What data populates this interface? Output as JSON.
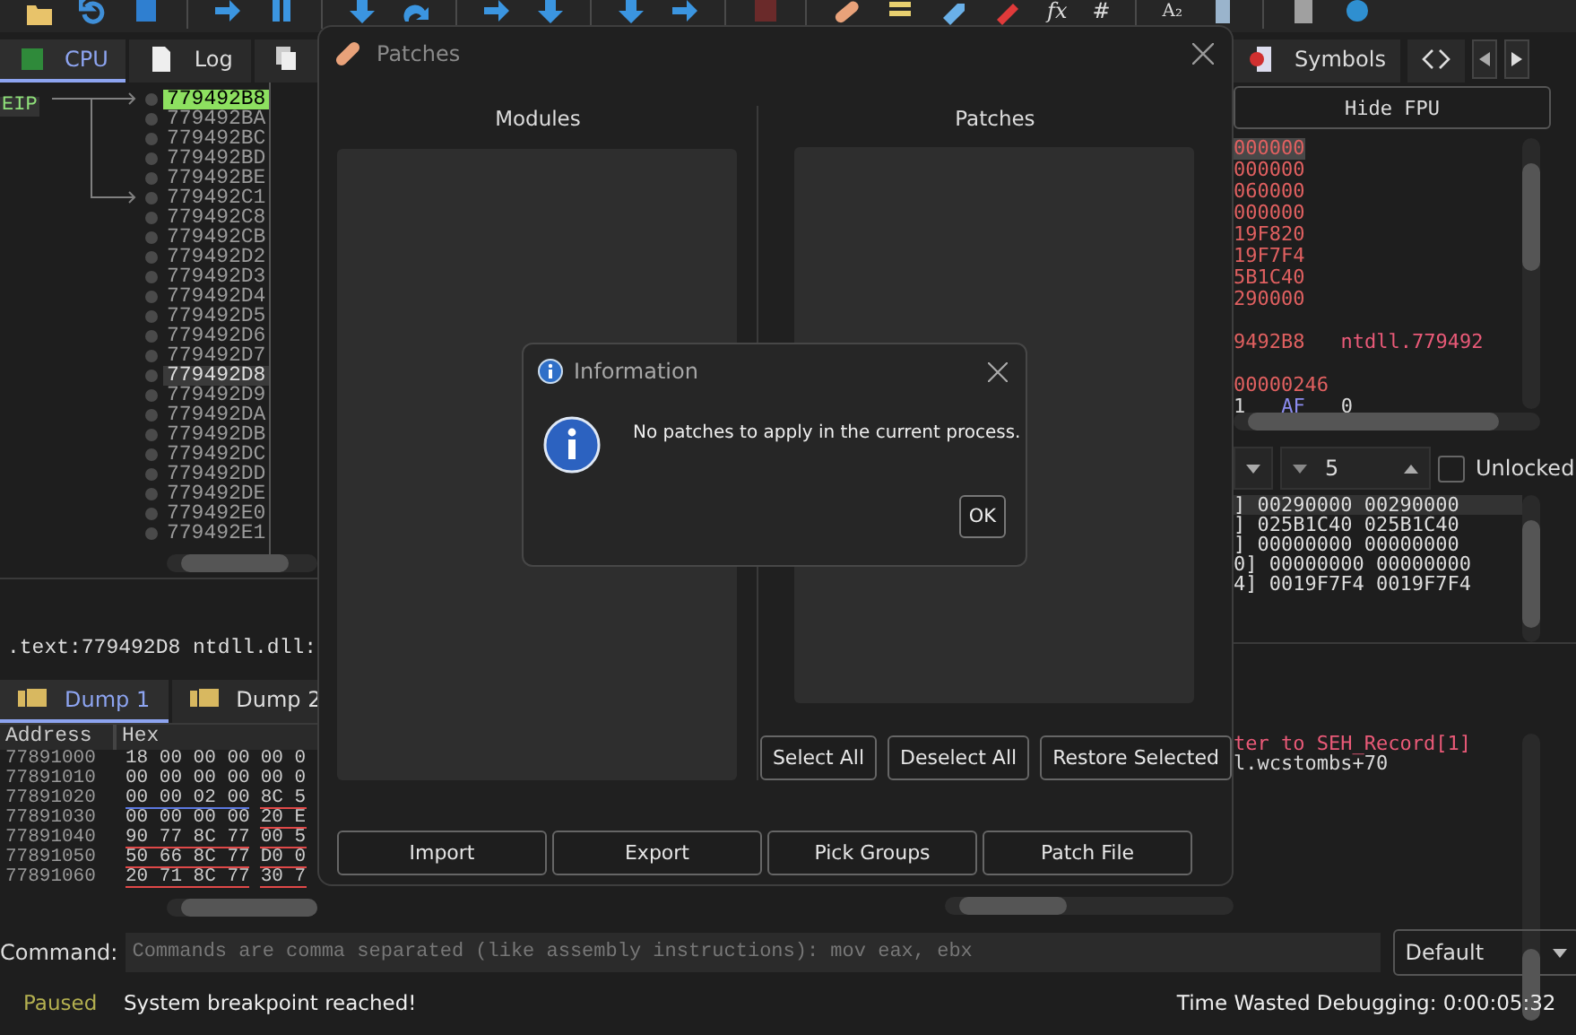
{
  "toolbar": {
    "glyph_buttons": [
      "fx",
      "#",
      "A₂"
    ]
  },
  "cpu_pane": {
    "tabs": [
      {
        "label": "CPU",
        "selected": true
      },
      {
        "label": "Log",
        "selected": false
      },
      {
        "selected": false
      }
    ]
  },
  "disassembly": {
    "eip_label": "EIP",
    "rows": [
      {
        "address": "779492B8",
        "eip": true,
        "selected": false
      },
      {
        "address": "779492BA",
        "eip": false,
        "selected": false
      },
      {
        "address": "779492BC",
        "eip": false,
        "selected": false
      },
      {
        "address": "779492BD",
        "eip": false,
        "selected": false
      },
      {
        "address": "779492BE",
        "eip": false,
        "selected": false
      },
      {
        "address": "779492C1",
        "eip": false,
        "selected": false
      },
      {
        "address": "779492C8",
        "eip": false,
        "selected": false
      },
      {
        "address": "779492CB",
        "eip": false,
        "selected": false
      },
      {
        "address": "779492D2",
        "eip": false,
        "selected": false
      },
      {
        "address": "779492D3",
        "eip": false,
        "selected": false
      },
      {
        "address": "779492D4",
        "eip": false,
        "selected": false
      },
      {
        "address": "779492D5",
        "eip": false,
        "selected": false
      },
      {
        "address": "779492D6",
        "eip": false,
        "selected": false
      },
      {
        "address": "779492D7",
        "eip": false,
        "selected": false
      },
      {
        "address": "779492D8",
        "eip": false,
        "selected": true
      },
      {
        "address": "779492D9",
        "eip": false,
        "selected": false
      },
      {
        "address": "779492DA",
        "eip": false,
        "selected": false
      },
      {
        "address": "779492DB",
        "eip": false,
        "selected": false
      },
      {
        "address": "779492DC",
        "eip": false,
        "selected": false
      },
      {
        "address": "779492DD",
        "eip": false,
        "selected": false
      },
      {
        "address": "779492DE",
        "eip": false,
        "selected": false
      },
      {
        "address": "779492E0",
        "eip": false,
        "selected": false
      },
      {
        "address": "779492E1",
        "eip": false,
        "selected": false
      }
    ]
  },
  "info_line": ".text:779492D8 ntdll.dll:",
  "dump_pane": {
    "tabs": [
      {
        "label": "Dump 1",
        "selected": true
      },
      {
        "label": "Dump 2",
        "selected": false
      }
    ],
    "columns": [
      "Address",
      "Hex"
    ],
    "rows": [
      {
        "address": "77891000",
        "groups": [
          {
            "text": "18 00 00 00"
          },
          {
            "text": "00 0"
          }
        ]
      },
      {
        "address": "77891010",
        "groups": [
          {
            "text": "00 00 00 00"
          },
          {
            "text": "00 0"
          }
        ]
      },
      {
        "address": "77891020",
        "groups": [
          {
            "text": "00 00 02 00",
            "color": "#5b78e0"
          },
          {
            "text": "8C 5",
            "color": "#e04848"
          }
        ]
      },
      {
        "address": "77891030",
        "groups": [
          {
            "text": "00 00 00 00"
          },
          {
            "text": "20 E",
            "color": "#e04848"
          }
        ]
      },
      {
        "address": "77891040",
        "groups": [
          {
            "text": "90 77 8C 77",
            "color": "#e04848"
          },
          {
            "text": "00 5",
            "color": "#e04848"
          }
        ]
      },
      {
        "address": "77891050",
        "groups": [
          {
            "text": "50 66 8C 77",
            "color": "#e04848"
          },
          {
            "text": "D0 0",
            "color": "#e04848"
          }
        ]
      },
      {
        "address": "77891060",
        "groups": [
          {
            "text": "20 71 8C 77",
            "color": "#e04848"
          },
          {
            "text": "30 7",
            "color": "#e04848"
          }
        ]
      }
    ]
  },
  "right_pane": {
    "tabs": [
      {
        "label": "Symbols",
        "selected": false
      },
      {
        "selected": false
      }
    ],
    "fpu_button": "Hide FPU",
    "register_groups": [
      [
        {
          "cells": [
            {
              "text": "000000",
              "kind": "changed"
            }
          ],
          "selected": true
        },
        {
          "cells": [
            {
              "text": "000000",
              "kind": "changed"
            }
          ],
          "selected": false
        },
        {
          "cells": [
            {
              "text": "060000",
              "kind": "changed"
            }
          ],
          "selected": false
        },
        {
          "cells": [
            {
              "text": "000000",
              "kind": "changed"
            }
          ],
          "selected": false
        },
        {
          "cells": [
            {
              "text": "19F820",
              "kind": "changed"
            }
          ],
          "selected": false
        },
        {
          "cells": [
            {
              "text": "19F7F4",
              "kind": "changed"
            }
          ],
          "selected": false
        },
        {
          "cells": [
            {
              "text": "5B1C40",
              "kind": "changed"
            }
          ],
          "selected": false
        },
        {
          "cells": [
            {
              "text": "290000",
              "kind": "changed"
            }
          ],
          "selected": false
        }
      ],
      [
        {
          "cells": [
            {
              "text": "9492B8",
              "kind": "changed"
            },
            {
              "text": "ntdll.779492",
              "kind": "comment"
            }
          ],
          "selected": false
        }
      ],
      [
        {
          "cells": [
            {
              "text": "00000246",
              "kind": "changed"
            }
          ],
          "selected": false
        },
        {
          "cells": [
            {
              "text": "1",
              "kind": "plain"
            },
            {
              "text": "AF",
              "kind": "flag"
            },
            {
              "text": "0",
              "kind": "plain"
            }
          ],
          "selected": false
        }
      ]
    ],
    "stack": {
      "depth": "5",
      "lock": {
        "label": "Unlocked",
        "checked": false
      },
      "rows": [
        {
          "text": "] 00290000 00290000",
          "selected": true
        },
        {
          "text": "] 025B1C40 025B1C40",
          "selected": false
        },
        {
          "text": "] 00000000 00000000",
          "selected": false
        },
        {
          "text": "0] 00000000 00000000",
          "selected": false
        },
        {
          "text": "4] 0019F7F4 0019F7F4",
          "selected": false
        }
      ]
    },
    "log_lines": [
      {
        "text": "ter to SEH_Record[1]",
        "kind": "comment"
      },
      {
        "text": "l.wcstombs+70",
        "kind": "plain"
      }
    ]
  },
  "command": {
    "label": "Command:",
    "placeholder": "Commands are comma separated (like assembly instructions): mov eax, ebx",
    "mode": "Default"
  },
  "status_bar": {
    "state": "Paused",
    "message": "System breakpoint reached!",
    "time": "Time Wasted Debugging: 0:00:05:32"
  },
  "patches_dialog": {
    "title": "Patches",
    "lists": [
      {
        "heading": "Modules"
      },
      {
        "heading": "Patches"
      }
    ],
    "patch_buttons": [
      "Select All",
      "Deselect All",
      "Restore Selected"
    ],
    "bottom_buttons": [
      "Import",
      "Export",
      "Pick Groups",
      "Patch File"
    ]
  },
  "info_dialog": {
    "title": "Information",
    "message": "No patches to apply in the current process.",
    "button": "OK"
  }
}
